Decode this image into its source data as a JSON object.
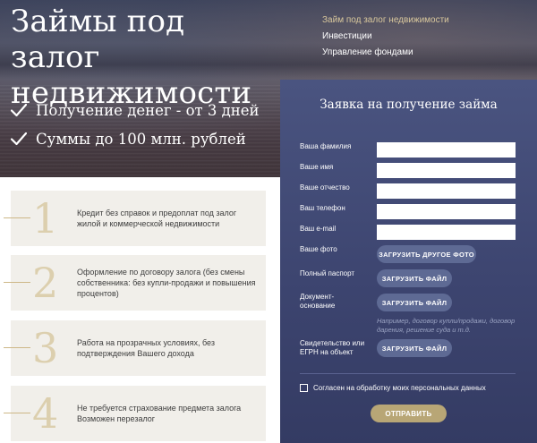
{
  "hero": {
    "title": "Займы под залог недвижимости",
    "benefits": [
      {
        "icon": "check-icon",
        "text": "Получение денег - от 3 дней"
      },
      {
        "icon": "check-icon",
        "text": "Суммы до 100 млн. рублей"
      }
    ]
  },
  "nav": {
    "items": [
      {
        "label": "Займ под залог недвижимости",
        "active": true
      },
      {
        "label": "Инвестиции",
        "active": false
      },
      {
        "label": "Управление фондами",
        "active": false
      }
    ]
  },
  "steps": [
    {
      "number": "1",
      "text": "Кредит без справок и предоплат под залог жилой и коммерческой недвижимости"
    },
    {
      "number": "2",
      "text": "Оформление по договору залога (без смены собственника: без купли-продажи и повышения процентов)"
    },
    {
      "number": "3",
      "text": "Работа на прозрачных условиях, без подтверждения Вашего дохода"
    },
    {
      "number": "4",
      "text": "Не требуется страхование предмета залога Возможен перезалог"
    }
  ],
  "form": {
    "title": "Заявка на получение займа",
    "fields": [
      {
        "label": "Ваша фамилия",
        "value": ""
      },
      {
        "label": "Ваше имя",
        "value": ""
      },
      {
        "label": "Ваше отчество",
        "value": ""
      },
      {
        "label": "Ваш телефон",
        "value": ""
      },
      {
        "label": "Ваш e-mail",
        "value": ""
      }
    ],
    "uploads": [
      {
        "label": "Ваше фото",
        "button": "ЗАГРУЗИТЬ ДРУГОЕ ФОТО"
      },
      {
        "label": "Полный паспорт",
        "button": "ЗАГРУЗИТЬ ФАЙЛ"
      },
      {
        "label": "Документ-основание",
        "button": "ЗАГРУЗИТЬ ФАЙЛ"
      },
      {
        "label": "Свидетельство или ЕГРН на объект",
        "button": "ЗАГРУЗИТЬ ФАЙЛ"
      }
    ],
    "hint": "Например, договор купли/продажи, договор дарения, решение суда и т.д.",
    "consent": {
      "label": "Согласен на обработку моих персональных данных",
      "checked": false
    },
    "submit": "ОТПРАВИТЬ"
  },
  "colors": {
    "accent_gold": "#b8a676",
    "nav_active": "#d8c79c",
    "panel": "#3d4570",
    "step_bg": "#f1efea",
    "step_number": "#dccfae"
  }
}
